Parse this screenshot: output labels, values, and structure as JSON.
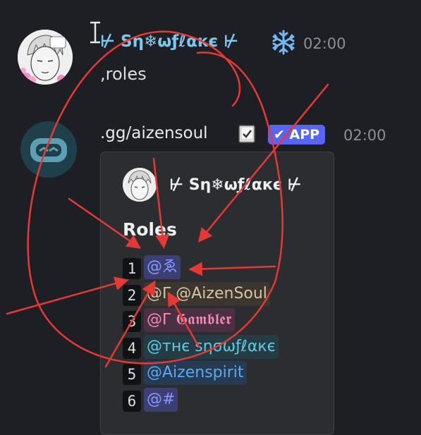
{
  "message1": {
    "username": "⊬ Sη❄ωƒℓαкє ⊬",
    "time": "02:00",
    "content": ",roles",
    "avatar_icon": "anime-avatar-icon",
    "status_icon": "snowflake-icon"
  },
  "message2": {
    "username": ".gg/aizensoul",
    "time": "02:00",
    "badge_label": "✔ APP",
    "avatar_icon": "bot-avatar-icon",
    "book_icon": "book-icon",
    "embed": {
      "author": "⊬ Sη❄ωƒℓαкє ⊬",
      "title": "Roles",
      "roles": [
        {
          "num": "1",
          "text": "@ゑ",
          "color": "#8b97ff",
          "bg": "#3c3f72"
        },
        {
          "num": "2",
          "text": "@ᒥ @AizenSoul",
          "color": "#d9c2a5",
          "bg": "#3c3631"
        },
        {
          "num": "3",
          "text": "@ᒥ 𝕲𝖆𝖒𝖇𝖑𝖊𝖗",
          "color": "#f18ab8",
          "bg": "#4a3040"
        },
        {
          "num": "4",
          "text": "@тнє ѕησωƒℓαкє",
          "color": "#5fcbe3",
          "bg": "#263c45"
        },
        {
          "num": "5",
          "text": "@Aizenspirit",
          "color": "#5aa9f2",
          "bg": "#263a52"
        },
        {
          "num": "6",
          "text": "@#",
          "color": "#8b97ff",
          "bg": "#3c3f72"
        }
      ]
    }
  },
  "colors": {
    "background": "#1e1f24",
    "username": "#7ec7ee",
    "app_badge": "#5865f2",
    "annotation": "#e53935"
  }
}
